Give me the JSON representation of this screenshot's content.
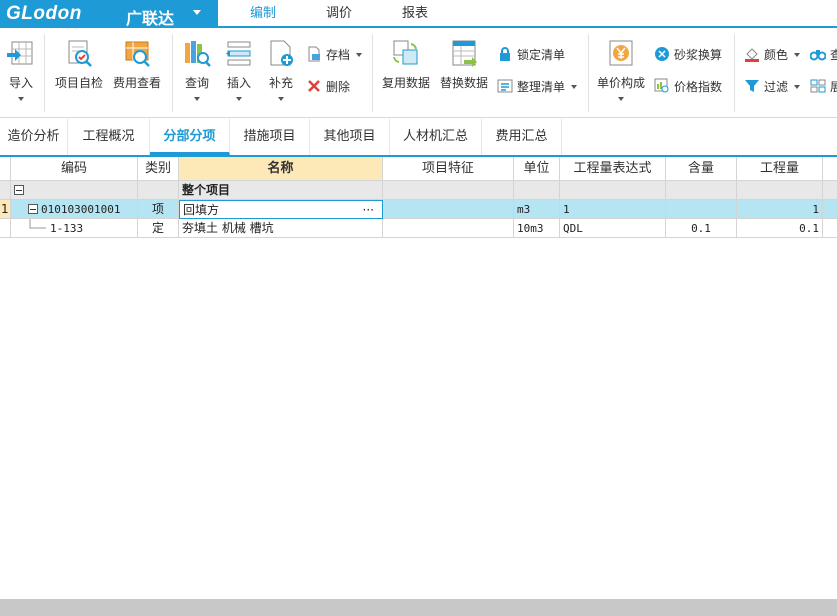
{
  "app": {
    "logo_text": "GLodon",
    "logo_cn": "广联达",
    "brand_color": "#1e9ad6"
  },
  "menu_tabs": [
    {
      "label": "编制",
      "active": true
    },
    {
      "label": "调价",
      "active": false
    },
    {
      "label": "报表",
      "active": false
    }
  ],
  "ribbon": {
    "import": "导入",
    "self_check": "项目自检",
    "fee_view": "费用查看",
    "query": "查询",
    "insert": "插入",
    "supplement": "补充",
    "archive": "存档",
    "delete": "删除",
    "reuse_data": "复用数据",
    "replace_data": "替换数据",
    "lock_list": "锁定清单",
    "sort_list": "整理清单",
    "unit_price_comp": "单价构成",
    "mortar_convert": "砂浆换算",
    "price_index": "价格指数",
    "color": "颜色",
    "find": "查",
    "filter": "过滤",
    "display": "展"
  },
  "page_tabs": [
    {
      "label": "造价分析",
      "active": false
    },
    {
      "label": "工程概况",
      "active": false
    },
    {
      "label": "分部分项",
      "active": true
    },
    {
      "label": "措施项目",
      "active": false
    },
    {
      "label": "其他项目",
      "active": false
    },
    {
      "label": "人材机汇总",
      "active": false
    },
    {
      "label": "费用汇总",
      "active": false
    }
  ],
  "grid": {
    "columns": [
      "编码",
      "类别",
      "名称",
      "项目特征",
      "单位",
      "工程量表达式",
      "含量",
      "工程量"
    ],
    "rows": [
      {
        "rownum": "",
        "code": "",
        "type": "",
        "name": "整个项目",
        "feature": "",
        "unit": "",
        "expr": "",
        "content": "",
        "qty": ""
      },
      {
        "rownum": "1",
        "code": "010103001001",
        "type": "项",
        "name": "回填方",
        "feature": "",
        "unit": "m3",
        "expr": "1",
        "content": "",
        "qty": "1"
      },
      {
        "rownum": "",
        "code": "1-133",
        "type": "定",
        "name": "夯填土 机械 槽坑",
        "feature": "",
        "unit": "10m3",
        "expr": "QDL",
        "content": "0.1",
        "qty": "0.1"
      }
    ],
    "ellipsis": "···"
  }
}
